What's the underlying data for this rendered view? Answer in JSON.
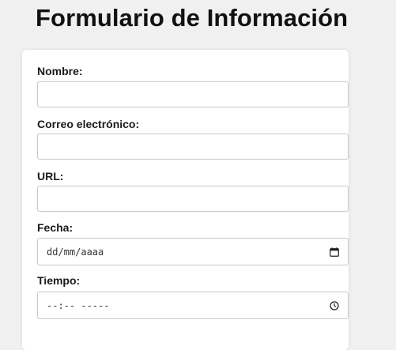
{
  "page": {
    "title": "Formulario de Información"
  },
  "form": {
    "fields": [
      {
        "label": "Nombre:",
        "value": ""
      },
      {
        "label": "Correo electrónico:",
        "value": ""
      },
      {
        "label": "URL:",
        "value": ""
      },
      {
        "label": "Fecha:",
        "placeholder": "dd/mm/aaaa",
        "icon": "calendar-icon"
      },
      {
        "label": "Tiempo:",
        "placeholder": "--:-- -----",
        "icon": "clock-icon"
      }
    ]
  },
  "colors": {
    "background": "#f0f0f0",
    "card": "#ffffff",
    "input_border": "#c8c8c8",
    "text": "#111111"
  }
}
